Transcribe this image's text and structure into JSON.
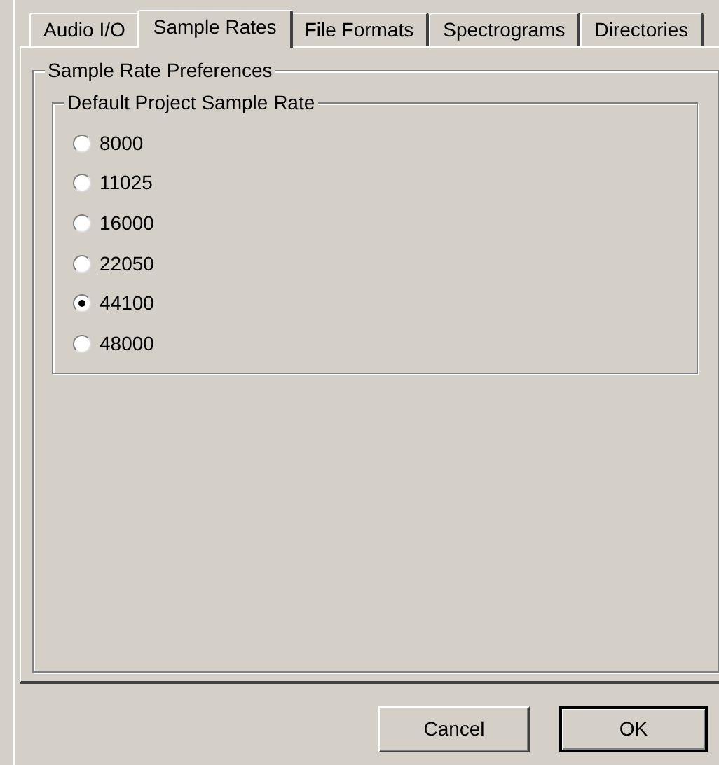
{
  "tabs": [
    {
      "label": "Audio I/O",
      "selected": false
    },
    {
      "label": "Sample Rates",
      "selected": true
    },
    {
      "label": "File Formats",
      "selected": false
    },
    {
      "label": "Spectrograms",
      "selected": false
    },
    {
      "label": "Directories",
      "selected": false
    }
  ],
  "outer_group": {
    "title": "Sample Rate Preferences"
  },
  "inner_group": {
    "title": "Default Project Sample Rate",
    "options": [
      {
        "label": "8000",
        "selected": false
      },
      {
        "label": "11025",
        "selected": false
      },
      {
        "label": "16000",
        "selected": false
      },
      {
        "label": "22050",
        "selected": false
      },
      {
        "label": "44100",
        "selected": true
      },
      {
        "label": "48000",
        "selected": false
      }
    ]
  },
  "buttons": [
    {
      "label": "Cancel",
      "default": false
    },
    {
      "label": "OK",
      "default": true
    }
  ]
}
